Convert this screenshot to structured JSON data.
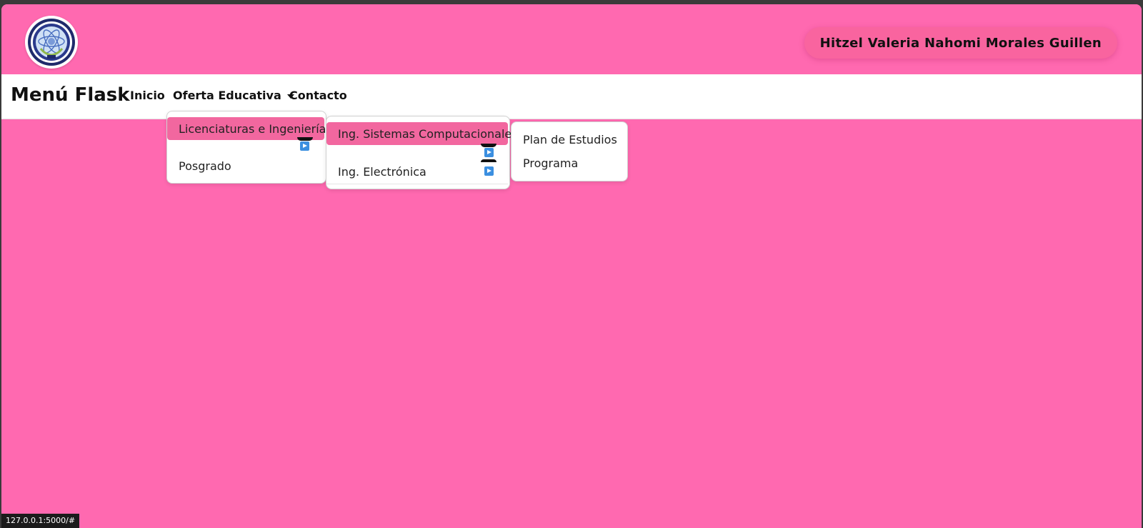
{
  "header": {
    "user_name": "Hitzel Valeria Nahomi Morales Guillen"
  },
  "navbar": {
    "brand": "Menú Flask",
    "links": {
      "inicio": "Inicio",
      "oferta": "Oferta Educativa",
      "contacto": "Contacto"
    }
  },
  "menu_level1": {
    "items": [
      "Licenciaturas e Ingenierías",
      "Posgrado"
    ]
  },
  "menu_level2": {
    "items": [
      "Ing. Sistemas Computacionales",
      "Ing. Electrónica"
    ]
  },
  "menu_level3": {
    "items": [
      "Plan de Estudios",
      "Programa"
    ]
  },
  "status": {
    "url": "127.0.0.1:5000/#"
  },
  "colors": {
    "background": "#ff69b0",
    "active_item": "#f2679f",
    "navbar": "#ffffff"
  },
  "icons": {
    "submenu_arrow": "play-arrow-icon",
    "logo": "school-seal-logo"
  }
}
